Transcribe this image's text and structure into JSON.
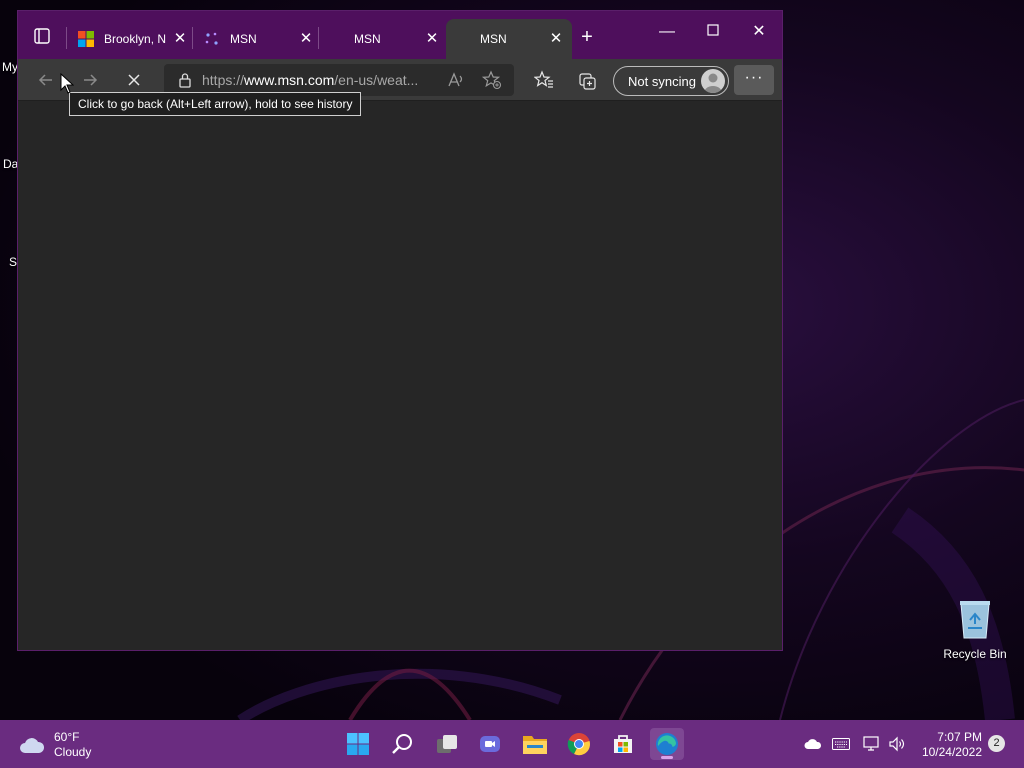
{
  "desktop": {
    "icons": [
      {
        "name": "recycle-bin",
        "label": "Recycle Bin"
      }
    ],
    "peek_labels": [
      "My",
      "Da",
      "Sl"
    ]
  },
  "browser": {
    "tabs": [
      {
        "title": "Brooklyn, N",
        "favicon": "microsoft-logo-icon",
        "active": false
      },
      {
        "title": "MSN",
        "favicon": "loading-dots-icon",
        "active": false
      },
      {
        "title": "MSN",
        "favicon": "",
        "active": false
      },
      {
        "title": "MSN",
        "favicon": "",
        "active": true
      }
    ],
    "address_bar": {
      "url_prefix": "https://",
      "url_host": "www.msn.com",
      "url_rest": "/en-us/weat..."
    },
    "sync_label": "Not syncing",
    "more_label": "···",
    "tooltip": "Click to go back (Alt+Left arrow), hold to see history"
  },
  "taskbar": {
    "weather": {
      "temp": "60°F",
      "condition": "Cloudy"
    },
    "clock": {
      "time": "7:07 PM",
      "date": "10/24/2022"
    },
    "notification_count": "2"
  },
  "colors": {
    "titlebar": "#4e0f5c",
    "taskbar": "#6a2c80",
    "content": "#262626"
  }
}
